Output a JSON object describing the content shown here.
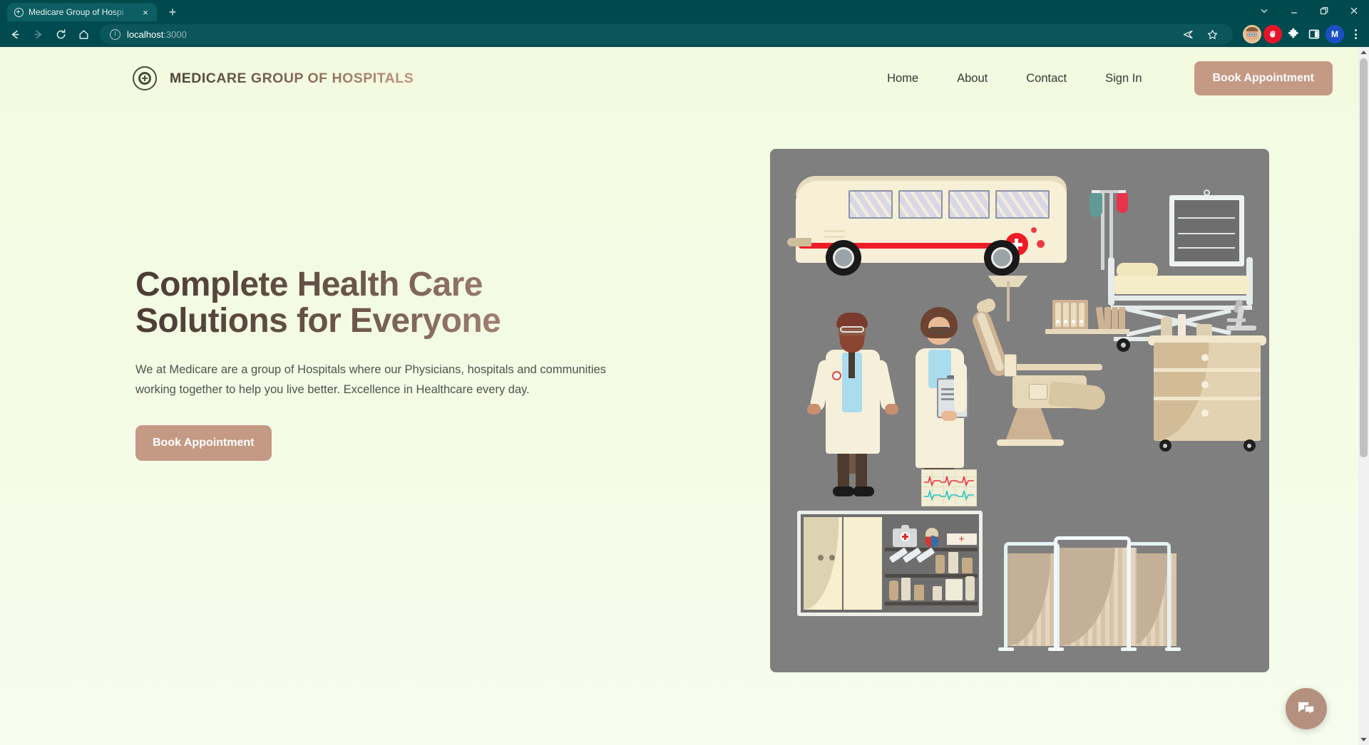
{
  "browser": {
    "tab": {
      "title": "Medicare Group of Hospi",
      "favicon": "medical-cross-favicon",
      "close": "×"
    },
    "new_tab": "+",
    "window_controls": {
      "expand": "∨",
      "minimize": "—",
      "maximize": "❐",
      "close": "✕"
    },
    "nav": {
      "back": "←",
      "forward": "→",
      "reload": "⟳",
      "home": "⌂"
    },
    "omnibox": {
      "info_icon": "i",
      "url_host": "localhost",
      "url_port": ":3000",
      "share_icon": "➤",
      "bookmark_icon": "☆"
    },
    "extensions": [
      {
        "name": "profile-avatar-extension",
        "glyph": ""
      },
      {
        "name": "adblock-shield-extension",
        "glyph": "✋"
      },
      {
        "name": "extensions-puzzle-icon",
        "glyph": "❖"
      },
      {
        "name": "side-panel-icon",
        "glyph": "▣"
      },
      {
        "name": "profile-avatar",
        "glyph": "M"
      }
    ],
    "menu_icon": "kebab-menu"
  },
  "site": {
    "brand": {
      "mark": "medical-cross-logo",
      "name": "MEDICARE GROUP OF HOSPITALS"
    },
    "nav_links": [
      {
        "label": "Home"
      },
      {
        "label": "About"
      },
      {
        "label": "Contact"
      },
      {
        "label": "Sign In"
      }
    ],
    "header_cta": "Book Appointment"
  },
  "hero": {
    "title_line1": "Complete Health Care",
    "title_line2": "Solutions for Everyone",
    "subtitle": "We at Medicare are a group of Hospitals where our Physicians, hospitals and communities working together to help you live better. Excellence in Healthcare every day.",
    "cta": "Book Appointment",
    "illustration_alt": "hospital-scene-illustration"
  },
  "widgets": {
    "chat_label": "chat-bubble-icon"
  },
  "colors": {
    "accent": "#c49a85",
    "brand_dark": "#4c4236",
    "brand_light": "#c09280",
    "page_bg": "#f3fae0",
    "illustration_bg": "#807f7f",
    "browser_chrome": "#004b4f",
    "tab_active": "#0c5e62",
    "text_body": "#4b544d"
  }
}
